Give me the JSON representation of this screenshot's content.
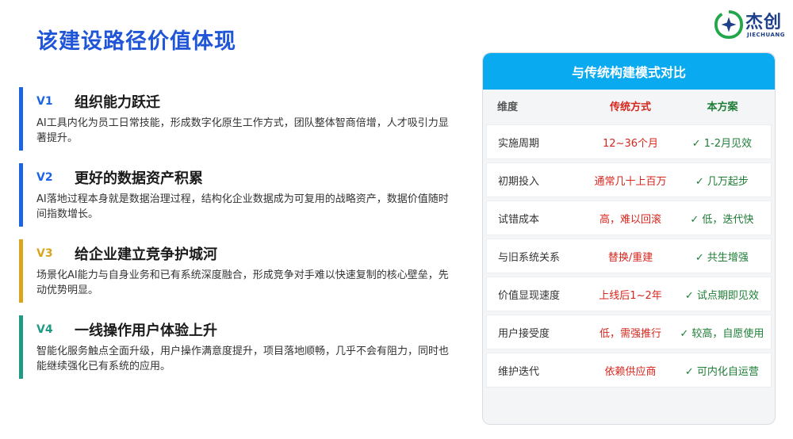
{
  "title": "该建设路径价值体现",
  "logo": {
    "name": "杰创",
    "sub": "JIECHUANG"
  },
  "values": [
    {
      "code": "V1",
      "color": "#1c63e6",
      "title": "组织能力跃迁",
      "desc": "AI工具内化为员工日常技能，形成数字化原生工作方式，团队整体智商倍增，人才吸引力显著提升。"
    },
    {
      "code": "V2",
      "color": "#1c63e6",
      "title": "更好的数据资产积累",
      "desc": "AI落地过程本身就是数据治理过程，结构化企业数据成为可复用的战略资产，数据价值随时间指数增长。"
    },
    {
      "code": "V3",
      "color": "#d9a51c",
      "title": "给企业建立竞争护城河",
      "desc": "场景化AI能力与自身业务和已有系统深度融合，形成竞争对手难以快速复制的核心壁垒，先动优势明显。"
    },
    {
      "code": "V4",
      "color": "#1f9a85",
      "title": "一线操作用户体验上升",
      "desc": "智能化服务触点全面升级，用户操作满意度提升，项目落地顺畅，几乎不会有阻力，同时也能继续强化已有系统的应用。"
    }
  ],
  "compare": {
    "title": "与传统构建模式对比",
    "headers": {
      "dim": "维度",
      "trad": "传统方式",
      "ours": "本方案"
    },
    "rows": [
      {
        "dim": "实施周期",
        "trad": "12~36个月",
        "ours": "✓ 1-2月见效"
      },
      {
        "dim": "初期投入",
        "trad": "通常几十上百万",
        "ours": "✓ 几万起步"
      },
      {
        "dim": "试错成本",
        "trad": "高，难以回滚",
        "ours": "✓ 低，迭代快"
      },
      {
        "dim": "与旧系统关系",
        "trad": "替换/重建",
        "ours": "✓ 共生增强"
      },
      {
        "dim": "价值显现速度",
        "trad": "上线后1~2年",
        "ours": "✓ 试点期即见效"
      },
      {
        "dim": "用户接受度",
        "trad": "低，需强推行",
        "ours": "✓ 较高，自愿使用"
      },
      {
        "dim": "维护迭代",
        "trad": "依赖供应商",
        "ours": "✓ 可内化自运营"
      }
    ]
  }
}
